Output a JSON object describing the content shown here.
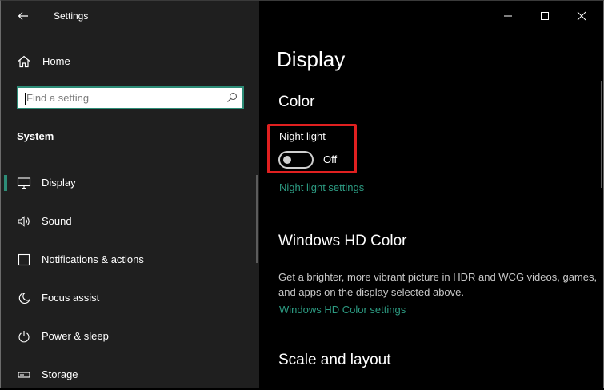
{
  "window": {
    "title": "Settings"
  },
  "sidebar": {
    "home_label": "Home",
    "search": {
      "placeholder": "Find a setting",
      "value": ""
    },
    "section_header": "System",
    "items": [
      {
        "label": "Display",
        "icon": "monitor-icon",
        "selected": true
      },
      {
        "label": "Sound",
        "icon": "speaker-icon",
        "selected": false
      },
      {
        "label": "Notifications & actions",
        "icon": "notification-icon",
        "selected": false
      },
      {
        "label": "Focus assist",
        "icon": "moon-icon",
        "selected": false
      },
      {
        "label": "Power & sleep",
        "icon": "power-icon",
        "selected": false
      },
      {
        "label": "Storage",
        "icon": "storage-icon",
        "selected": false
      }
    ]
  },
  "main": {
    "page_title": "Display",
    "color_section": {
      "heading": "Color",
      "night_light": {
        "label": "Night light",
        "state": "Off",
        "on": false
      },
      "settings_link": "Night light settings"
    },
    "hd_color_section": {
      "heading": "Windows HD Color",
      "description": "Get a brighter, more vibrant picture in HDR and WCG videos, games, and apps on the display selected above.",
      "settings_link": "Windows HD Color settings"
    },
    "scale_section": {
      "heading": "Scale and layout"
    }
  },
  "colors": {
    "accent": "#2d8c77",
    "link": "#2d9c83",
    "highlight": "#e02020",
    "sidebar_bg": "#1f1f1f",
    "main_bg": "#000000"
  }
}
